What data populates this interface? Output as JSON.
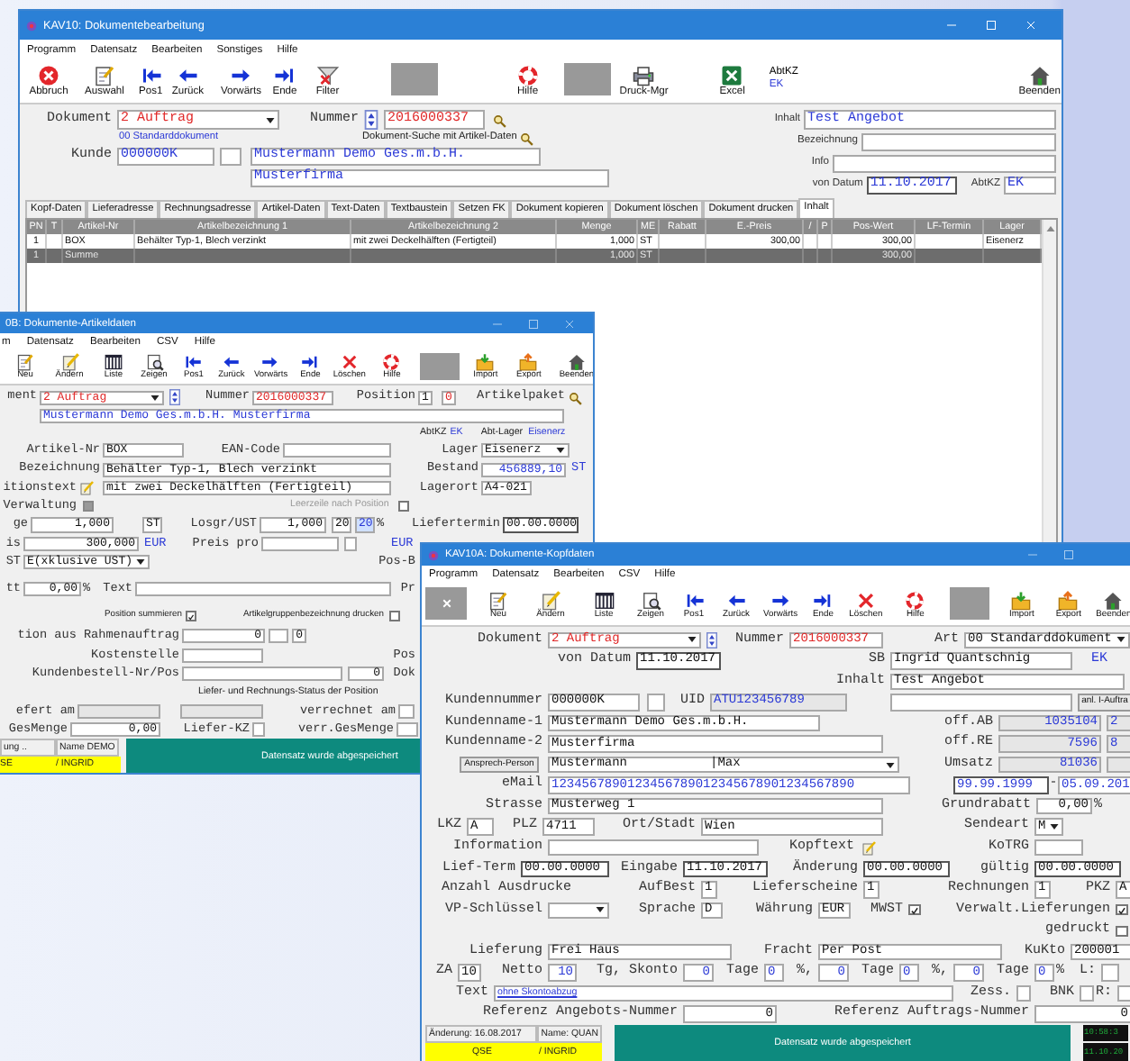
{
  "main_window": {
    "title": "KAV10: Dokumentebearbeitung",
    "menu": [
      "Programm",
      "Datensatz",
      "Bearbeiten",
      "Sonstiges",
      "Hilfe"
    ],
    "toolbar": [
      {
        "kind": "tool",
        "label": "Abbruch"
      },
      {
        "kind": "tool",
        "label": "Auswahl"
      },
      {
        "kind": "tool",
        "label": "Pos1"
      },
      {
        "kind": "tool",
        "label": "Zurück"
      },
      {
        "kind": "tool",
        "label": "Vorwärts"
      },
      {
        "kind": "tool",
        "label": "Ende"
      },
      {
        "kind": "tool",
        "label": "Filter"
      },
      {
        "kind": "tile"
      },
      {
        "kind": "tool",
        "label": "Hilfe"
      },
      {
        "kind": "tile"
      },
      {
        "kind": "tool",
        "label": "Druck-Mgr"
      },
      {
        "kind": "tool",
        "label": "Excel"
      },
      {
        "kind": "tag",
        "label": "AbtKZ",
        "value": "EK"
      },
      {
        "kind": "tool",
        "label": "Beenden"
      }
    ],
    "form_left": [
      [
        {
          "kind": "label",
          "text": "Dokument"
        },
        {
          "kind": "select",
          "value": "2 Auftrag"
        },
        {
          "kind": "label",
          "text": "Nummer"
        },
        {
          "kind": "spin"
        },
        {
          "kind": "field",
          "value": "2016000337"
        },
        {
          "kind": "lookup"
        }
      ],
      [
        {
          "kind": "note",
          "text": "00 Standarddokument"
        },
        {
          "kind": "note",
          "text": "Dokument-Suche mit Artikel-Daten"
        },
        {
          "kind": "lookup"
        }
      ],
      [
        {
          "kind": "label",
          "text": "Kunde"
        },
        {
          "kind": "field",
          "value": "000000K"
        },
        {
          "kind": "field"
        },
        {
          "kind": "field",
          "value": "Mustermann Demo Ges.m.b.H."
        }
      ],
      [
        {
          "kind": "field",
          "value": "Musterfirma"
        }
      ]
    ],
    "form_right": [
      [
        {
          "kind": "label",
          "text": "Inhalt"
        },
        {
          "kind": "field",
          "value": "Test Angebot"
        }
      ],
      [
        {
          "kind": "label",
          "text": "Bezeichnung"
        },
        {
          "kind": "field"
        }
      ],
      [
        {
          "kind": "label",
          "text": "Info"
        },
        {
          "kind": "field"
        }
      ],
      [
        {
          "kind": "label",
          "text": "von Datum"
        },
        {
          "kind": "field",
          "value": "11.10.2017"
        },
        {
          "kind": "label",
          "text": "AbtKZ"
        },
        {
          "kind": "field",
          "value": "EK"
        }
      ]
    ],
    "tabs": [
      {
        "label": "Kopf-Daten",
        "selected": false
      },
      {
        "label": "Lieferadresse",
        "selected": false
      },
      {
        "label": "Rechnungsadresse",
        "selected": false
      },
      {
        "label": "Artikel-Daten",
        "selected": false
      },
      {
        "label": "Text-Daten",
        "selected": false
      },
      {
        "label": "Textbaustein",
        "selected": false
      },
      {
        "label": "Setzen FK",
        "selected": false
      },
      {
        "label": "Dokument kopieren",
        "selected": false
      },
      {
        "label": "Dokument löschen",
        "selected": false
      },
      {
        "label": "Dokument drucken",
        "selected": false
      },
      {
        "label": "Inhalt",
        "selected": true
      }
    ],
    "table": {
      "columns": [
        "PN",
        "T",
        "Artikel-Nr",
        "Artikelbezeichnung 1",
        "Artikelbezeichnung 2",
        "Menge",
        "ME",
        "Rabatt",
        "E.-Preis",
        "/",
        "P",
        "Pos-Wert",
        "LF-Termin",
        "Lager"
      ],
      "rows": [
        {
          "kind": "item",
          "cells": [
            "1",
            null,
            "BOX",
            "Behälter Typ-1, Blech verzinkt",
            "mit zwei Deckelhälften (Fertigteil)",
            "1,000",
            "ST",
            null,
            "300,00",
            null,
            null,
            "300,00",
            null,
            "Eisenerz"
          ]
        },
        {
          "kind": "total",
          "cells": [
            "1",
            null,
            "Summe",
            null,
            null,
            "1,000",
            "ST",
            null,
            null,
            null,
            null,
            "300,00",
            null,
            null
          ]
        }
      ]
    }
  },
  "article_window": {
    "title": "0B: Dokumente-Artikeldaten",
    "menu": [
      "m",
      "Datensatz",
      "Bearbeiten",
      "CSV",
      "Hilfe"
    ],
    "toolbar": [
      {
        "kind": "tool",
        "label": "Neu"
      },
      {
        "kind": "tool",
        "label": "Ändern"
      },
      {
        "kind": "tool",
        "label": "Liste"
      },
      {
        "kind": "tool",
        "label": "Zeigen"
      },
      {
        "kind": "tool",
        "label": "Pos1"
      },
      {
        "kind": "tool",
        "label": "Zurück"
      },
      {
        "kind": "tool",
        "label": "Vorwärts"
      },
      {
        "kind": "tool",
        "label": "Ende"
      },
      {
        "kind": "tool",
        "label": "Löschen"
      },
      {
        "kind": "tool",
        "label": "Hilfe"
      },
      {
        "kind": "tile"
      },
      {
        "kind": "tool",
        "label": "Import"
      },
      {
        "kind": "tool",
        "label": "Export"
      },
      {
        "kind": "tool",
        "label": "Beenden"
      }
    ],
    "form": [
      [
        {
          "kind": "label",
          "text": "ment"
        },
        {
          "kind": "select",
          "value": "2 Auftrag"
        },
        {
          "kind": "spin"
        },
        {
          "kind": "label",
          "text": "Nummer"
        },
        {
          "kind": "field",
          "value": "2016000337"
        },
        {
          "kind": "label",
          "text": "Position"
        },
        {
          "kind": "field",
          "value": "1"
        },
        {
          "kind": "field",
          "value": "0"
        },
        {
          "kind": "label",
          "text": "Artikelpaket"
        },
        {
          "kind": "lookup"
        }
      ],
      [
        {
          "kind": "field",
          "value": "Mustermann Demo Ges.m.b.H. Musterfirma"
        }
      ],
      [
        {
          "kind": "note",
          "text": "AbtKZ"
        },
        {
          "kind": "note",
          "text": "EK"
        },
        {
          "kind": "note",
          "text": "Abt-Lager"
        },
        {
          "kind": "note",
          "text": "Eisenerz"
        }
      ],
      [
        {
          "kind": "label",
          "text": "Artikel-Nr"
        },
        {
          "kind": "field",
          "value": "BOX"
        },
        {
          "kind": "label",
          "text": "EAN-Code"
        },
        {
          "kind": "field"
        },
        {
          "kind": "label",
          "text": "Lager"
        },
        {
          "kind": "select",
          "value": "Eisenerz"
        }
      ],
      [
        {
          "kind": "label",
          "text": "Bezeichnung"
        },
        {
          "kind": "field",
          "value": "Behälter Typ-1, Blech verzinkt"
        },
        {
          "kind": "label",
          "text": "Bestand"
        },
        {
          "kind": "field",
          "value": "456889,10"
        },
        {
          "kind": "label",
          "text": "ST"
        }
      ],
      [
        {
          "kind": "label",
          "text": "itionstext"
        },
        {
          "kind": "edit"
        },
        {
          "kind": "field",
          "value": "mit zwei Deckelhälften (Fertigteil)"
        },
        {
          "kind": "label",
          "text": "Lagerort"
        },
        {
          "kind": "field",
          "value": "A4-021"
        }
      ],
      [
        {
          "kind": "label",
          "text": "Verwaltung"
        },
        {
          "kind": "check",
          "checked": false,
          "disabled": true
        },
        {
          "kind": "note",
          "text": "Leerzeile nach Position"
        },
        {
          "kind": "check",
          "checked": false,
          "disabled": false
        }
      ],
      [
        {
          "kind": "label",
          "text": "ge"
        },
        {
          "kind": "field",
          "value": "1,000"
        },
        {
          "kind": "field",
          "value": "ST"
        },
        {
          "kind": "label",
          "text": "Losgr/UST"
        },
        {
          "kind": "field",
          "value": "1,000"
        },
        {
          "kind": "field",
          "value": "20"
        },
        {
          "kind": "field",
          "value": "20"
        },
        {
          "kind": "label",
          "text": "%"
        },
        {
          "kind": "label",
          "text": "Liefertermin"
        },
        {
          "kind": "field",
          "value": "00.00.0000"
        }
      ],
      [
        {
          "kind": "label",
          "text": "is"
        },
        {
          "kind": "field",
          "value": "300,000"
        },
        {
          "kind": "label",
          "text": "EUR"
        },
        {
          "kind": "label",
          "text": "Preis pro"
        },
        {
          "kind": "field"
        },
        {
          "kind": "field"
        },
        {
          "kind": "label",
          "text": "EUR"
        }
      ],
      [
        {
          "kind": "label",
          "text": "ST"
        },
        {
          "kind": "select",
          "value": "E(xklusive UST)"
        },
        {
          "kind": "label",
          "text": "Pos-B"
        }
      ],
      [
        {
          "kind": "label",
          "text": "tt"
        },
        {
          "kind": "field",
          "value": "0,00"
        },
        {
          "kind": "label",
          "text": "%"
        },
        {
          "kind": "label",
          "text": "Text"
        },
        {
          "kind": "field"
        },
        {
          "kind": "label",
          "text": "Pr"
        }
      ],
      [
        {
          "kind": "note",
          "text": "Position summieren"
        },
        {
          "kind": "check",
          "checked": true,
          "disabled": false
        },
        {
          "kind": "note",
          "text": "Artikelgruppenbezeichnung drucken"
        },
        {
          "kind": "check",
          "checked": false,
          "disabled": false
        }
      ],
      [
        {
          "kind": "label",
          "text": "tion aus Rahmenauftrag"
        },
        {
          "kind": "field",
          "value": "0"
        },
        {
          "kind": "field"
        },
        {
          "kind": "field",
          "value": "0"
        }
      ],
      [
        {
          "kind": "label",
          "text": "Kostenstelle"
        },
        {
          "kind": "field"
        },
        {
          "kind": "label",
          "text": "Pos"
        }
      ],
      [
        {
          "kind": "label",
          "text": "Kundenbestell-Nr/Pos"
        },
        {
          "kind": "field"
        },
        {
          "kind": "field",
          "value": "0"
        },
        {
          "kind": "label",
          "text": "Dok"
        }
      ],
      [
        {
          "kind": "note",
          "text": "Liefer- und Rechnungs-Status der Position"
        }
      ],
      [
        {
          "kind": "label",
          "text": "efert am"
        },
        {
          "kind": "field"
        },
        {
          "kind": "field"
        },
        {
          "kind": "label",
          "text": "verrechnet am"
        },
        {
          "kind": "field"
        }
      ],
      [
        {
          "kind": "label",
          "text": "GesMenge"
        },
        {
          "kind": "field",
          "value": "0,00"
        },
        {
          "kind": "label",
          "text": "Liefer-KZ"
        },
        {
          "kind": "field"
        },
        {
          "kind": "label",
          "text": "verr.GesMenge"
        },
        {
          "kind": "field"
        }
      ]
    ],
    "status": {
      "info": [
        "ung ..",
        "Name DEMO"
      ],
      "user": [
        "SE",
        "/ INGRID"
      ],
      "message": "Datensatz wurde abgespeichert"
    }
  },
  "header_window": {
    "title": "KAV10A: Dokumente-Kopfdaten",
    "menu": [
      "Programm",
      "Datensatz",
      "Bearbeiten",
      "CSV",
      "Hilfe"
    ],
    "toolbar": [
      {
        "kind": "tile"
      },
      {
        "kind": "tool",
        "label": "Neu"
      },
      {
        "kind": "tool",
        "label": "Ändern"
      },
      {
        "kind": "tool",
        "label": "Liste"
      },
      {
        "kind": "tool",
        "label": "Zeigen"
      },
      {
        "kind": "tool",
        "label": "Pos1"
      },
      {
        "kind": "tool",
        "label": "Zurück"
      },
      {
        "kind": "tool",
        "label": "Vorwärts"
      },
      {
        "kind": "tool",
        "label": "Ende"
      },
      {
        "kind": "tool",
        "label": "Löschen"
      },
      {
        "kind": "tool",
        "label": "Hilfe"
      },
      {
        "kind": "tile"
      },
      {
        "kind": "tool",
        "label": "Import"
      },
      {
        "kind": "tool",
        "label": "Export"
      },
      {
        "kind": "tool",
        "label": "Beenden"
      }
    ],
    "form": [
      [
        {
          "kind": "label",
          "text": "Dokument"
        },
        {
          "kind": "select",
          "value": "2 Auftrag"
        },
        {
          "kind": "spin"
        },
        {
          "kind": "label",
          "text": "Nummer"
        },
        {
          "kind": "field",
          "value": "2016000337"
        },
        {
          "kind": "label",
          "text": "Art"
        },
        {
          "kind": "select",
          "value": "00 Standarddokument"
        }
      ],
      [
        {
          "kind": "label",
          "text": "von Datum"
        },
        {
          "kind": "field",
          "value": "11.10.2017"
        },
        {
          "kind": "label",
          "text": "SB"
        },
        {
          "kind": "field",
          "value": "Ingrid Quantschnig"
        },
        {
          "kind": "label",
          "text": "EK"
        }
      ],
      [
        {
          "kind": "label",
          "text": "Inhalt"
        },
        {
          "kind": "field",
          "value": "Test Angebot"
        }
      ],
      [
        {
          "kind": "label",
          "text": "Kundennummer"
        },
        {
          "kind": "field",
          "value": "000000K"
        },
        {
          "kind": "field"
        },
        {
          "kind": "label",
          "text": "UID"
        },
        {
          "kind": "field",
          "value": "ATU123456789"
        },
        {
          "kind": "field"
        },
        {
          "kind": "button",
          "text": "anl. I-Auftra"
        }
      ],
      [
        {
          "kind": "label",
          "text": "Kundenname-1"
        },
        {
          "kind": "field",
          "value": "Mustermann Demo Ges.m.b.H."
        },
        {
          "kind": "label",
          "text": "off.AB"
        },
        {
          "kind": "field",
          "value": "1035104"
        },
        {
          "kind": "field",
          "value": "2"
        }
      ],
      [
        {
          "kind": "label",
          "text": "Kundenname-2"
        },
        {
          "kind": "field",
          "value": "Musterfirma"
        },
        {
          "kind": "label",
          "text": "off.RE"
        },
        {
          "kind": "field",
          "value": "7596"
        },
        {
          "kind": "field",
          "value": "8"
        }
      ],
      [
        {
          "kind": "button",
          "text": "Ansprech-Person"
        },
        {
          "kind": "select",
          "value": "Mustermann",
          "extra": "|Max"
        },
        {
          "kind": "label",
          "text": "Umsatz"
        },
        {
          "kind": "field",
          "value": "81036"
        },
        {
          "kind": "field"
        }
      ],
      [
        {
          "kind": "label",
          "text": "eMail"
        },
        {
          "kind": "field",
          "value": "1234567890123456789012345678901234567890"
        },
        {
          "kind": "field",
          "value": "99.99.1999"
        },
        {
          "kind": "label",
          "text": "-"
        },
        {
          "kind": "field",
          "value": "05.09.201"
        }
      ],
      [
        {
          "kind": "label",
          "text": "Strasse"
        },
        {
          "kind": "field",
          "value": "Musterweg 1"
        },
        {
          "kind": "label",
          "text": "Grundrabatt"
        },
        {
          "kind": "field",
          "value": "0,00"
        },
        {
          "kind": "label",
          "text": "%"
        }
      ],
      [
        {
          "kind": "label",
          "text": "LKZ"
        },
        {
          "kind": "field",
          "value": "A"
        },
        {
          "kind": "label",
          "text": "PLZ"
        },
        {
          "kind": "field",
          "value": "4711"
        },
        {
          "kind": "label",
          "text": "Ort/Stadt"
        },
        {
          "kind": "field",
          "value": "Wien"
        },
        {
          "kind": "label",
          "text": "Sendeart"
        },
        {
          "kind": "select",
          "value": "M"
        }
      ],
      [
        {
          "kind": "label",
          "text": "Information"
        },
        {
          "kind": "field"
        },
        {
          "kind": "label",
          "text": "Kopftext"
        },
        {
          "kind": "edit"
        },
        {
          "kind": "label",
          "text": "KoTRG"
        },
        {
          "kind": "field"
        }
      ],
      [
        {
          "kind": "label",
          "text": "Lief-Term"
        },
        {
          "kind": "field",
          "value": "00.00.0000"
        },
        {
          "kind": "label",
          "text": "Eingabe"
        },
        {
          "kind": "field",
          "value": "11.10.2017"
        },
        {
          "kind": "label",
          "text": "Änderung"
        },
        {
          "kind": "field",
          "value": "00.00.0000"
        },
        {
          "kind": "label",
          "text": "gültig"
        },
        {
          "kind": "field",
          "value": "00.00.0000"
        }
      ],
      [
        {
          "kind": "label",
          "text": "Anzahl Ausdrucke"
        },
        {
          "kind": "label",
          "text": "AufBest"
        },
        {
          "kind": "field",
          "value": "1"
        },
        {
          "kind": "label",
          "text": "Lieferscheine"
        },
        {
          "kind": "field",
          "value": "1"
        },
        {
          "kind": "label",
          "text": "Rechnungen"
        },
        {
          "kind": "field",
          "value": "1"
        },
        {
          "kind": "label",
          "text": "PKZ"
        },
        {
          "kind": "field",
          "value": "A"
        }
      ],
      [
        {
          "kind": "label",
          "text": "VP-Schlüssel"
        },
        {
          "kind": "select"
        },
        {
          "kind": "label",
          "text": "Sprache"
        },
        {
          "kind": "field",
          "value": "D"
        },
        {
          "kind": "label",
          "text": "Währung"
        },
        {
          "kind": "field",
          "value": "EUR"
        },
        {
          "kind": "label",
          "text": "MWST"
        },
        {
          "kind": "check",
          "checked": true,
          "disabled": false
        },
        {
          "kind": "label",
          "text": "Verwalt.Lieferungen"
        },
        {
          "kind": "check",
          "checked": true,
          "disabled": false
        }
      ],
      [
        {
          "kind": "label",
          "text": "gedruckt"
        },
        {
          "kind": "check",
          "checked": false,
          "disabled": false
        }
      ],
      [
        {
          "kind": "label",
          "text": "Lieferung"
        },
        {
          "kind": "field",
          "value": "Frei Haus"
        },
        {
          "kind": "label",
          "text": "Fracht"
        },
        {
          "kind": "field",
          "value": "Per Post"
        },
        {
          "kind": "label",
          "text": "KuKto"
        },
        {
          "kind": "field",
          "value": "200001"
        }
      ],
      [
        {
          "kind": "label",
          "text": "ZA"
        },
        {
          "kind": "field",
          "value": "10"
        },
        {
          "kind": "label",
          "text": "Netto"
        },
        {
          "kind": "field",
          "value": "10"
        },
        {
          "kind": "label",
          "text": "Tg, Skonto"
        },
        {
          "kind": "field",
          "value": "0"
        },
        {
          "kind": "label",
          "text": "Tage"
        },
        {
          "kind": "field",
          "value": "0"
        },
        {
          "kind": "label",
          "text": "%,"
        },
        {
          "kind": "field",
          "value": "0"
        },
        {
          "kind": "label",
          "text": "Tage"
        },
        {
          "kind": "field",
          "value": "0"
        },
        {
          "kind": "label",
          "text": "%,"
        },
        {
          "kind": "field",
          "value": "0"
        },
        {
          "kind": "label",
          "text": "Tage"
        },
        {
          "kind": "field",
          "value": "0"
        },
        {
          "kind": "label",
          "text": "%"
        },
        {
          "kind": "label",
          "text": "L:"
        },
        {
          "kind": "field"
        }
      ],
      [
        {
          "kind": "label",
          "text": "Text"
        },
        {
          "kind": "field",
          "value": "ohne Skontoabzug"
        },
        {
          "kind": "label",
          "text": "Zess."
        },
        {
          "kind": "field"
        },
        {
          "kind": "label",
          "text": "BNK"
        },
        {
          "kind": "field"
        },
        {
          "kind": "label",
          "text": "R:"
        },
        {
          "kind": "field"
        }
      ],
      [
        {
          "kind": "label",
          "text": "Referenz Angebots-Nummer"
        },
        {
          "kind": "field",
          "value": "0"
        },
        {
          "kind": "label",
          "text": "Referenz Auftrags-Nummer"
        },
        {
          "kind": "field",
          "value": "0"
        }
      ]
    ],
    "status": {
      "info": [
        "Änderung: 16.08.2017",
        "Name: QUAN"
      ],
      "user": [
        "QSE",
        "/ INGRID"
      ],
      "message": "Datensatz wurde abgespeichert",
      "clock": [
        "10:58:3",
        "11.10.20"
      ]
    }
  }
}
